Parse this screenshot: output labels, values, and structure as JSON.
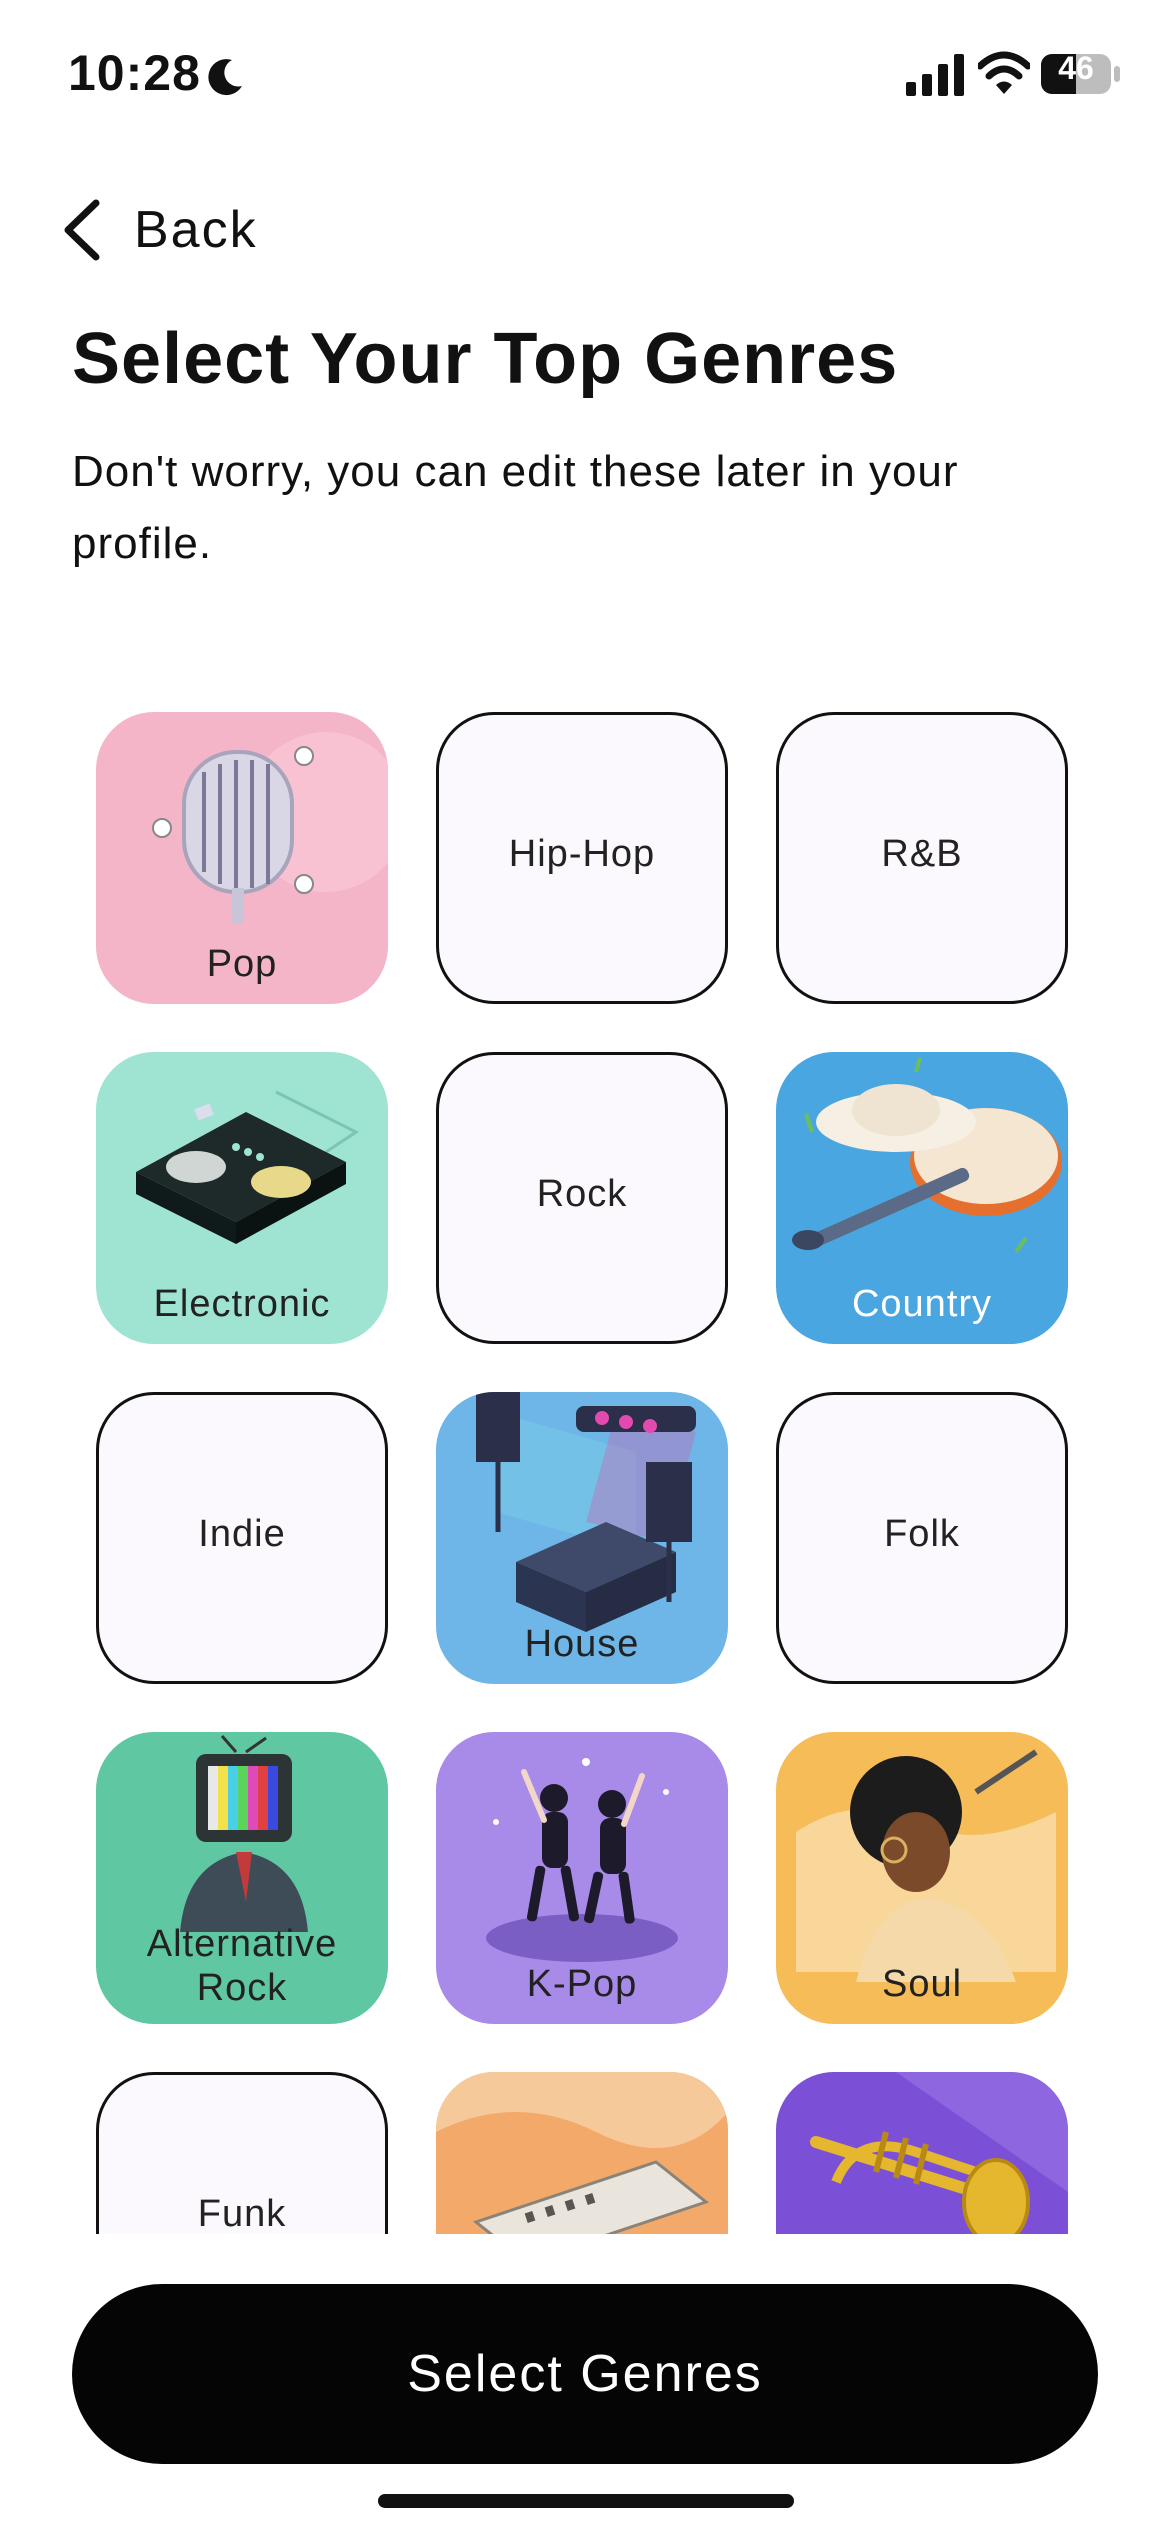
{
  "status_bar": {
    "time": "10:28",
    "battery": "46"
  },
  "nav": {
    "back_label": "Back"
  },
  "header": {
    "title": "Select Your Top Genres",
    "subtitle": "Don't worry, you can edit these later in your profile."
  },
  "genres": [
    {
      "label": "Pop",
      "style": "image",
      "color": "#f4b5c8",
      "icon": "microphone-illustration"
    },
    {
      "label": "Hip-Hop",
      "style": "plain"
    },
    {
      "label": "R&B",
      "style": "plain"
    },
    {
      "label": "Electronic",
      "style": "image",
      "color": "#9fe3d2",
      "icon": "dj-mixer-illustration"
    },
    {
      "label": "Rock",
      "style": "plain"
    },
    {
      "label": "Country",
      "style": "image",
      "color": "#4aa6e0",
      "icon": "guitar-hat-illustration"
    },
    {
      "label": "Indie",
      "style": "plain"
    },
    {
      "label": "House",
      "style": "image",
      "color": "#6fb6e8",
      "icon": "dj-stage-illustration"
    },
    {
      "label": "Folk",
      "style": "plain"
    },
    {
      "label": "Alternative\nRock",
      "style": "image",
      "color": "#5fc8a3",
      "icon": "tv-head-illustration"
    },
    {
      "label": "K-Pop",
      "style": "image",
      "color": "#a88ae8",
      "icon": "dancers-illustration"
    },
    {
      "label": "Soul",
      "style": "image",
      "color": "#f5bc58",
      "icon": "soul-singer-illustration"
    },
    {
      "label": "Funk",
      "style": "plain"
    },
    {
      "label": "",
      "style": "image",
      "color": "#f2a96a",
      "icon": "harmonica-illustration"
    },
    {
      "label": "",
      "style": "image",
      "color": "#7b50d6",
      "icon": "trumpet-illustration"
    }
  ],
  "footer": {
    "primary_button": "Select Genres"
  }
}
